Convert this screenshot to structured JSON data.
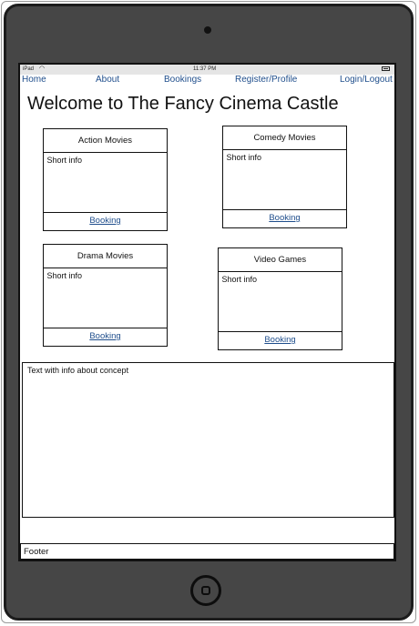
{
  "statusbar": {
    "device": "iPad",
    "time": "11:37 PM"
  },
  "nav": {
    "home": "Home",
    "about": "About",
    "bookings": "Bookings",
    "register": "Register/Profile",
    "login": "Login/Logout"
  },
  "page_title": "Welcome to The Fancy Cinema Castle",
  "cards": [
    {
      "title": "Action Movies",
      "info": "Short info",
      "link": "Booking"
    },
    {
      "title": "Comedy Movies",
      "info": "Short info",
      "link": "Booking"
    },
    {
      "title": "Drama Movies",
      "info": "Short info",
      "link": "Booking"
    },
    {
      "title": "Video Games",
      "info": "Short info",
      "link": "Booking"
    }
  ],
  "concept": {
    "text": "Text with info about concept"
  },
  "footer": {
    "text": "Footer"
  },
  "icons": {
    "wifi": "wifi-icon",
    "battery": "battery-icon",
    "home_button": "home-button-icon",
    "camera": "camera-icon"
  },
  "colors": {
    "link": "#1f4e8c",
    "device_frame": "#464646",
    "statusbar": "#e5e5e5"
  }
}
